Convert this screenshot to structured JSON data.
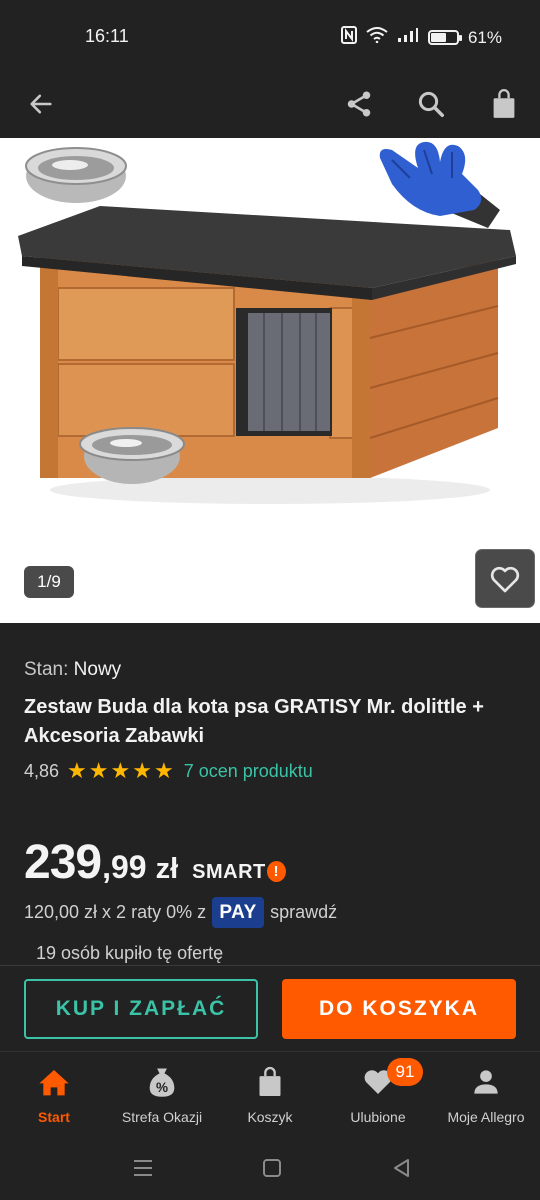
{
  "status_bar": {
    "time": "16:11",
    "battery_percent": "61%",
    "battery_level": 0.61
  },
  "toolbar": {
    "icons": [
      "back-arrow-icon",
      "share-icon",
      "search-icon",
      "shopping-bag-icon"
    ]
  },
  "gallery": {
    "counter": "1/9"
  },
  "product": {
    "condition_label": "Stan:",
    "condition_value": "Nowy",
    "title": "Zestaw Buda dla kota psa GRATISY Mr. dolittle + Akcesoria Zabawki",
    "rating_value": "4,86",
    "stars": 5,
    "rating_link": "7 ocen produktu",
    "price_integer": "239",
    "price_fraction": ",99",
    "price_currency": "zł",
    "smart_label": "SMART",
    "smart_mark": "!",
    "installments_text": "120,00 zł x 2 raty 0% z",
    "pay_badge": "PAY",
    "installments_link": "sprawdź",
    "bought_text": "19 osób kupiło tę ofertę"
  },
  "actions": {
    "buy_now": "KUP I ZAPŁAĆ",
    "add_to_cart": "DO KOSZYKA"
  },
  "bottom_nav": {
    "items": [
      {
        "label": "Start",
        "icon": "home-icon",
        "active": true
      },
      {
        "label": "Strefa Okazji",
        "icon": "discount-tag-icon",
        "active": false
      },
      {
        "label": "Koszyk",
        "icon": "cart-bag-icon",
        "active": false
      },
      {
        "label": "Ulubione",
        "icon": "heart-icon",
        "active": false,
        "badge": "91"
      },
      {
        "label": "Moje Allegro",
        "icon": "user-icon",
        "active": false
      }
    ]
  },
  "colors": {
    "background": "#222222",
    "accent_orange": "#ff5a00",
    "accent_teal": "#3bc3a7",
    "star": "#ffb800",
    "pay_blue": "#1c3e8f"
  }
}
